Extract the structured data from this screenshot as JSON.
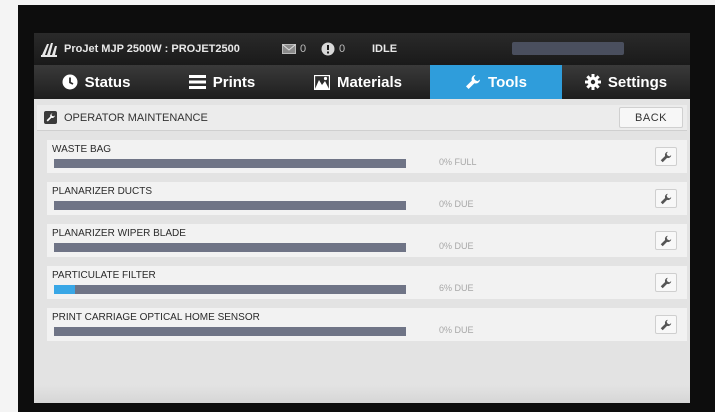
{
  "status_bar": {
    "printer_name": "ProJet MJP 2500W : PROJET2500",
    "message_count": "0",
    "alert_count": "0",
    "state": "IDLE",
    "icons": [
      "3dsystems-logo-icon",
      "envelope-icon",
      "alert-icon"
    ]
  },
  "tabs": [
    {
      "label": "Status",
      "icon": "clock-icon",
      "active": false
    },
    {
      "label": "Prints",
      "icon": "list-icon",
      "active": false
    },
    {
      "label": "Materials",
      "icon": "materials-icon",
      "active": false
    },
    {
      "label": "Tools",
      "icon": "wrench-icon",
      "active": true
    },
    {
      "label": "Settings",
      "icon": "gear-icon",
      "active": false
    }
  ],
  "section": {
    "title": "OPERATOR MAINTENANCE",
    "back_label": "BACK"
  },
  "maintenance_items": [
    {
      "label": "WASTE BAG",
      "status": "0% FULL",
      "percent": 0
    },
    {
      "label": "PLANARIZER DUCTS",
      "status": "0% DUE",
      "percent": 0
    },
    {
      "label": "PLANARIZER WIPER BLADE",
      "status": "0% DUE",
      "percent": 0
    },
    {
      "label": "PARTICULATE FILTER",
      "status": "6% DUE",
      "percent": 6
    },
    {
      "label": "PRINT CARRIAGE OPTICAL HOME SENSOR",
      "status": "0% DUE",
      "percent": 0
    }
  ],
  "colors": {
    "accent": "#2f9ddb",
    "bar_background": "#6f7486",
    "bar_fill": "#39a7e6"
  }
}
